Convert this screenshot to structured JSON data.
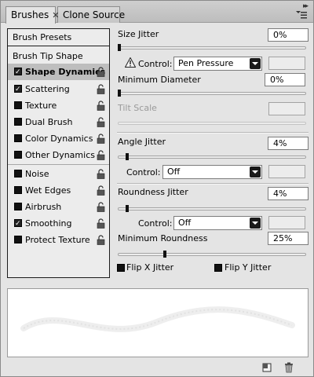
{
  "tabs": [
    {
      "label": "Brushes",
      "active": true,
      "close": "✕"
    },
    {
      "label": "Clone Source",
      "active": false
    }
  ],
  "left": {
    "brush_presets": "Brush Presets",
    "brush_tip_shape": "Brush Tip Shape",
    "items": [
      {
        "label": "Shape Dynamics",
        "checked": true,
        "selected": true
      },
      {
        "label": "Scattering",
        "checked": true,
        "selected": false
      },
      {
        "label": "Texture",
        "checked": false,
        "selected": false
      },
      {
        "label": "Dual Brush",
        "checked": false,
        "selected": false
      },
      {
        "label": "Color Dynamics",
        "checked": false,
        "selected": false
      },
      {
        "label": "Other Dynamics",
        "checked": false,
        "selected": false
      },
      {
        "label": "Noise",
        "checked": false,
        "selected": false
      },
      {
        "label": "Wet Edges",
        "checked": false,
        "selected": false
      },
      {
        "label": "Airbrush",
        "checked": false,
        "selected": false
      },
      {
        "label": "Smoothing",
        "checked": true,
        "selected": false
      },
      {
        "label": "Protect Texture",
        "checked": false,
        "selected": false
      }
    ]
  },
  "right": {
    "size_jitter": {
      "label": "Size Jitter",
      "value": "0%",
      "slider": 0.0
    },
    "control1": {
      "label": "Control:",
      "value": "Pen Pressure"
    },
    "min_diameter": {
      "label": "Minimum Diameter",
      "value": "0%",
      "slider": 0.0
    },
    "tilt_scale": {
      "label": "Tilt Scale"
    },
    "angle_jitter": {
      "label": "Angle Jitter",
      "value": "4%",
      "slider": 0.04
    },
    "control2": {
      "label": "Control:",
      "value": "Off"
    },
    "roundness_jitter": {
      "label": "Roundness Jitter",
      "value": "4%",
      "slider": 0.04
    },
    "control3": {
      "label": "Control:",
      "value": "Off"
    },
    "min_roundness": {
      "label": "Minimum Roundness",
      "value": "25%",
      "slider": 0.25
    },
    "flip_x": {
      "label": "Flip X Jitter",
      "checked": false
    },
    "flip_y": {
      "label": "Flip Y Jitter",
      "checked": false
    }
  },
  "icons": {
    "lock": "lock-icon",
    "warning": "warning-icon",
    "new_preset": "new-preset-icon",
    "trash": "trash-icon",
    "panel_menu": "panel-menu-icon",
    "collapse": "collapse-icon"
  }
}
